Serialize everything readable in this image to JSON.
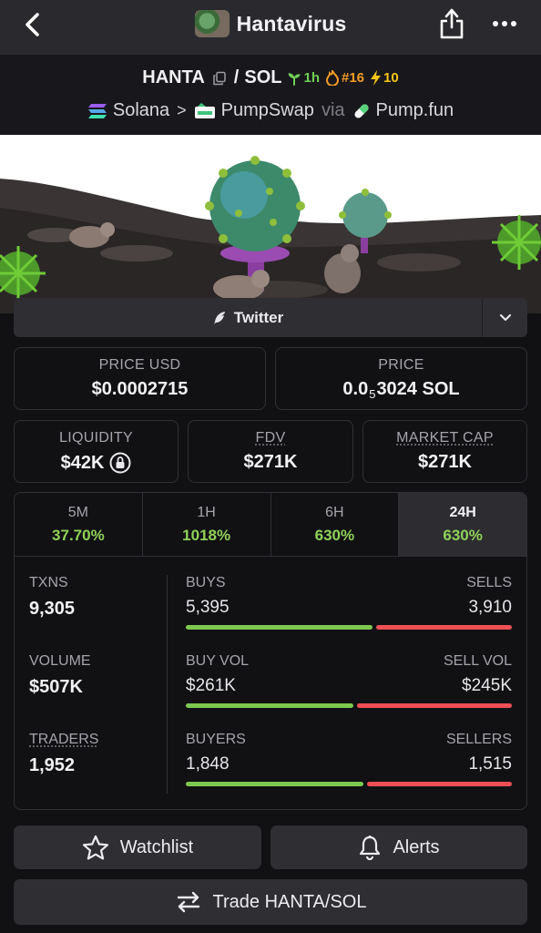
{
  "header": {
    "title": "Hantavirus"
  },
  "pair": {
    "base": "HANTA",
    "slash": "/",
    "quote": "SOL",
    "age": "1h",
    "rank": "#16",
    "boosts": "10"
  },
  "chain": {
    "network": "Solana",
    "separator": ">",
    "dex": "PumpSwap",
    "via": "via",
    "launchpad": "Pump.fun"
  },
  "links": {
    "twitter_label": "Twitter"
  },
  "stats": {
    "price_usd_label": "PRICE USD",
    "price_usd": "$0.0002715",
    "price_label": "PRICE",
    "price_prefix": "0.0",
    "price_zeros": "5",
    "price_suffix": "3024 SOL",
    "liquidity_label": "LIQUIDITY",
    "liquidity": "$42K",
    "fdv_label": "FDV",
    "fdv": "$271K",
    "mcap_label": "MARKET CAP",
    "mcap": "$271K"
  },
  "tabs": [
    {
      "label": "5M",
      "value": "37.70%"
    },
    {
      "label": "1H",
      "value": "1018%"
    },
    {
      "label": "6H",
      "value": "630%"
    },
    {
      "label": "24H",
      "value": "630%"
    }
  ],
  "active_tab": "24H",
  "activity": {
    "txns_label": "TXNS",
    "txns": "9,305",
    "volume_label": "VOLUME",
    "volume": "$507K",
    "traders_label": "TRADERS",
    "traders": "1,952",
    "buys_label": "BUYS",
    "buys": "5,395",
    "sells_label": "SELLS",
    "sells": "3,910",
    "buy_share": 0.58,
    "buy_vol_label": "BUY VOL",
    "buy_vol": "$261K",
    "sell_vol_label": "SELL VOL",
    "sell_vol": "$245K",
    "buy_vol_share": 0.52,
    "buyers_label": "BUYERS",
    "buyers": "1,848",
    "sellers_label": "SELLERS",
    "sellers": "1,515",
    "buyers_share": 0.55
  },
  "actions": {
    "watchlist": "Watchlist",
    "alerts": "Alerts",
    "trade": "Trade HANTA/SOL"
  },
  "colors": {
    "positive": "#8fd158",
    "buy_bar": "#7ec850",
    "sell_bar": "#ee4f55",
    "age_badge": "#6fcf55",
    "rank_badge": "#f39b25",
    "boost_badge": "#f5c518"
  }
}
